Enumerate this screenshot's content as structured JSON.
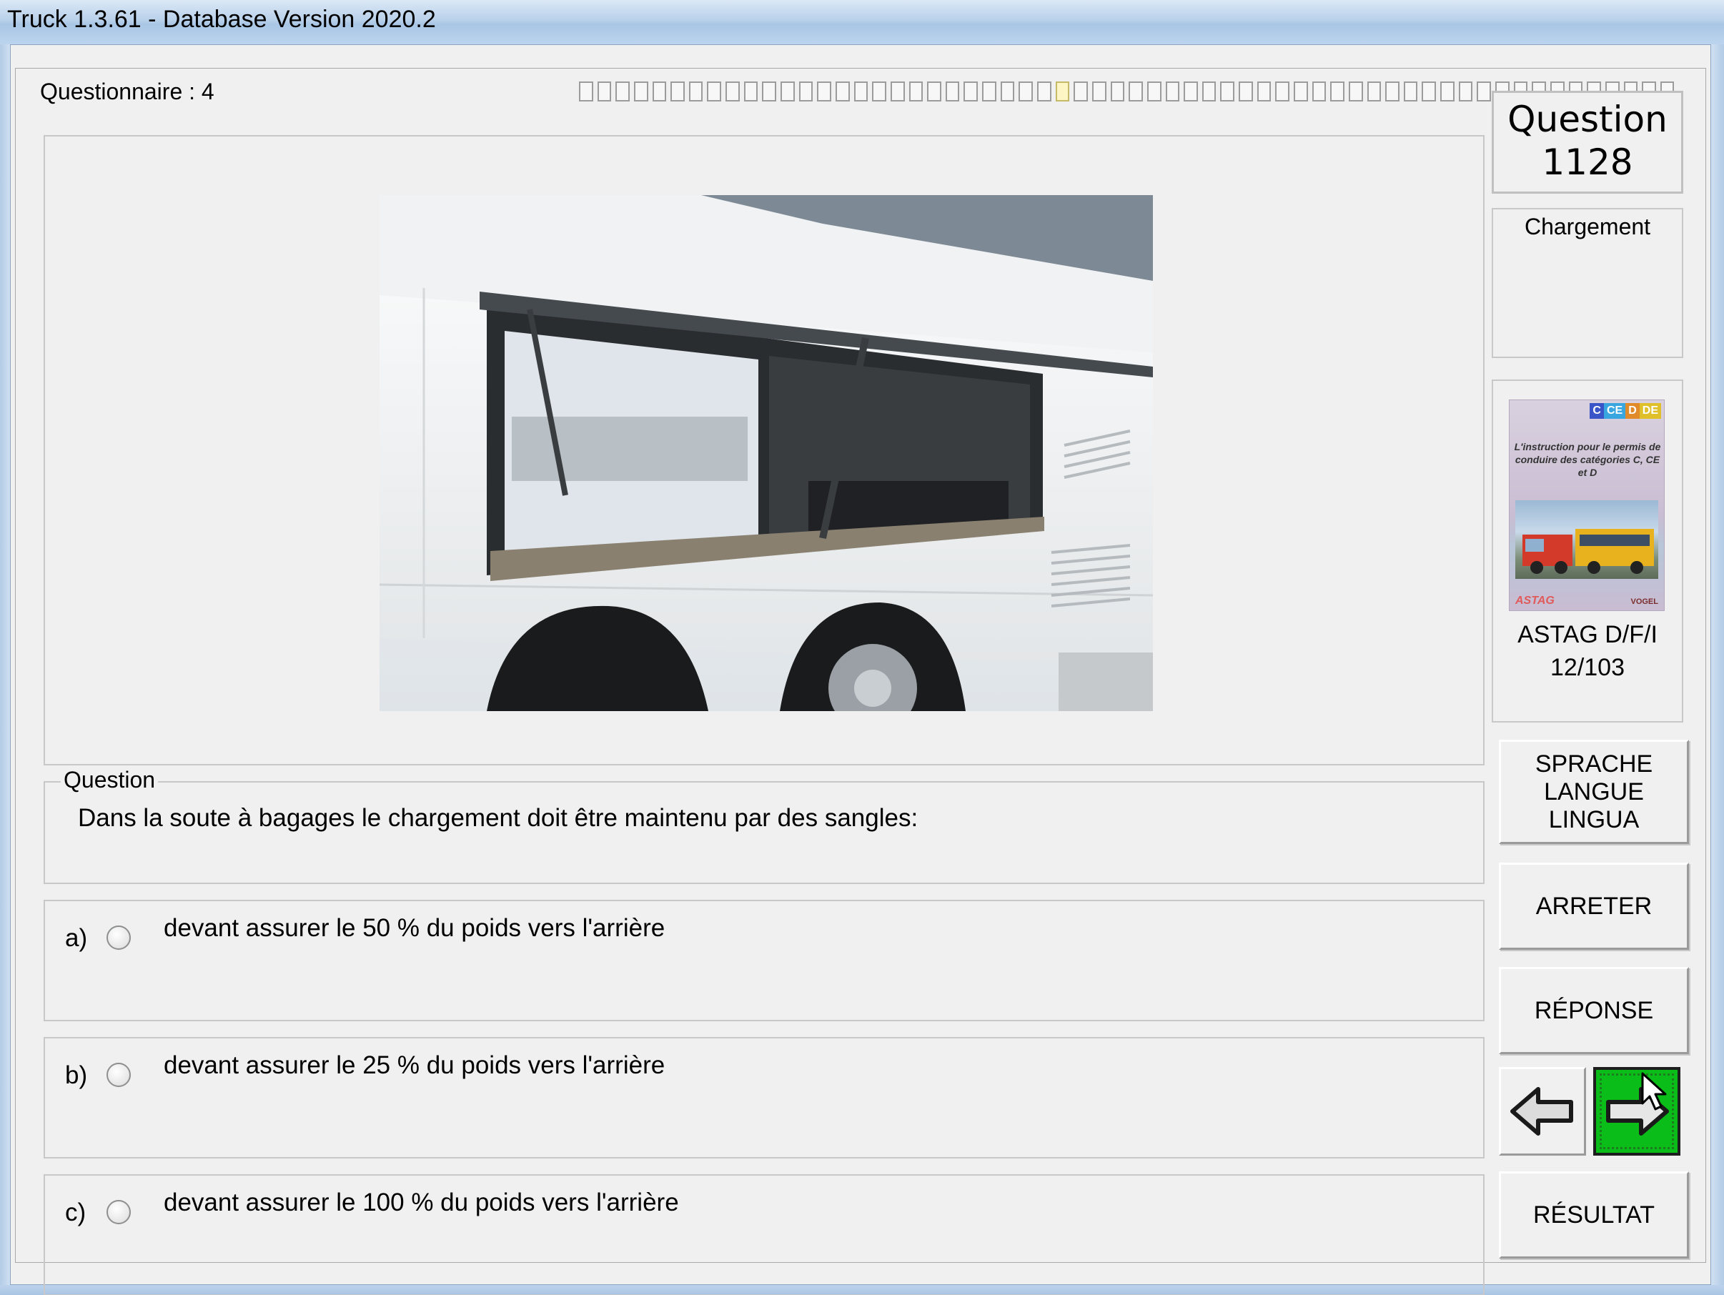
{
  "window": {
    "title": "Truck 1.3.61 - Database Version 2020.2"
  },
  "questionnaire": {
    "label": "Questionnaire : 4",
    "progress": {
      "segments": 60,
      "current": 26
    }
  },
  "question": {
    "legend": "Question",
    "text": "Dans la soute à bagages le chargement doit être maintenu par des sangles:",
    "image_icon": "bus-luggage-compartment-photo"
  },
  "answers": [
    {
      "letter": "a)",
      "text": "devant assurer le 50 % du poids vers l'arrière",
      "selected": false
    },
    {
      "letter": "b)",
      "text": "devant assurer le 25 % du poids vers l'arrière",
      "selected": false
    },
    {
      "letter": "c)",
      "text": "devant assurer le 100 % du poids vers l'arrière",
      "selected": false
    }
  ],
  "sidebar": {
    "question_label": "Question",
    "question_number": "1128",
    "category": "Chargement",
    "book": {
      "tags": [
        "C",
        "CE",
        "D",
        "DE"
      ],
      "tag_colors": [
        "#3a55c8",
        "#3aa6e0",
        "#e08a2a",
        "#e0c02a"
      ],
      "cover_title": "L'instruction pour le permis de conduire des catégories C, CE et D",
      "publisher_left": "ASTAG",
      "publisher_right": "VOGEL",
      "caption": "ASTAG D/F/I",
      "reference": "12/103"
    }
  },
  "buttons": {
    "language": [
      "SPRACHE",
      "LANGUE",
      "LINGUA"
    ],
    "stop": "ARRETER",
    "answer": "RÉPONSE",
    "prev_icon": "arrow-left-icon",
    "next_icon": "arrow-right-icon",
    "result": "RÉSULTAT"
  },
  "colors": {
    "next_button": "#0bbd19",
    "window_frame": "#b9d1ea"
  }
}
